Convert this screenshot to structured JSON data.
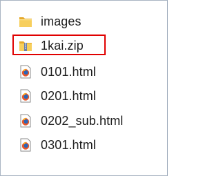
{
  "files": [
    {
      "name": "images",
      "icon": "folder-icon"
    },
    {
      "name": "1kai.zip",
      "icon": "zip-folder-icon"
    },
    {
      "name": "0101.html",
      "icon": "firefox-html-icon"
    },
    {
      "name": "0201.html",
      "icon": "firefox-html-icon"
    },
    {
      "name": "0202_sub.html",
      "icon": "firefox-html-icon"
    },
    {
      "name": "0301.html",
      "icon": "firefox-html-icon"
    }
  ],
  "colors": {
    "highlight": "#e00000",
    "folder": "#f5c142",
    "border": "#a9b4c3"
  }
}
